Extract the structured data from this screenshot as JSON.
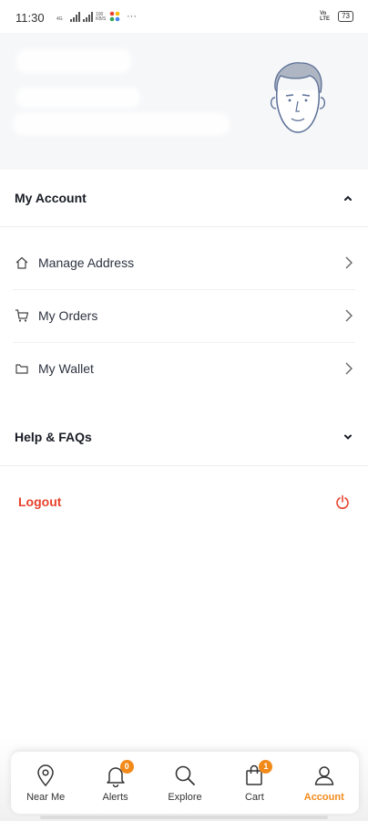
{
  "status_bar": {
    "time": "11:30",
    "signal_text": "4G",
    "speed_text": "100 KB/S",
    "dots": "···",
    "volte": "Vo LTE",
    "battery": "73"
  },
  "account_section": {
    "title": "My Account",
    "items": [
      {
        "label": "Manage Address",
        "icon": "home-icon"
      },
      {
        "label": "My Orders",
        "icon": "cart-icon"
      },
      {
        "label": "My Wallet",
        "icon": "wallet-icon"
      }
    ]
  },
  "help_section": {
    "title": "Help & FAQs"
  },
  "logout": {
    "label": "Logout"
  },
  "bottom_nav": {
    "items": [
      {
        "label": "Near Me",
        "icon": "location-pin-icon"
      },
      {
        "label": "Alerts",
        "icon": "bell-icon",
        "badge": "0"
      },
      {
        "label": "Explore",
        "icon": "search-icon"
      },
      {
        "label": "Cart",
        "icon": "shopping-bag-icon",
        "badge": "1"
      },
      {
        "label": "Account",
        "icon": "user-icon",
        "active": true
      }
    ]
  },
  "colors": {
    "accent": "#f28a1a",
    "logout": "#e8432e",
    "header_bg": "#f6f7f9"
  }
}
